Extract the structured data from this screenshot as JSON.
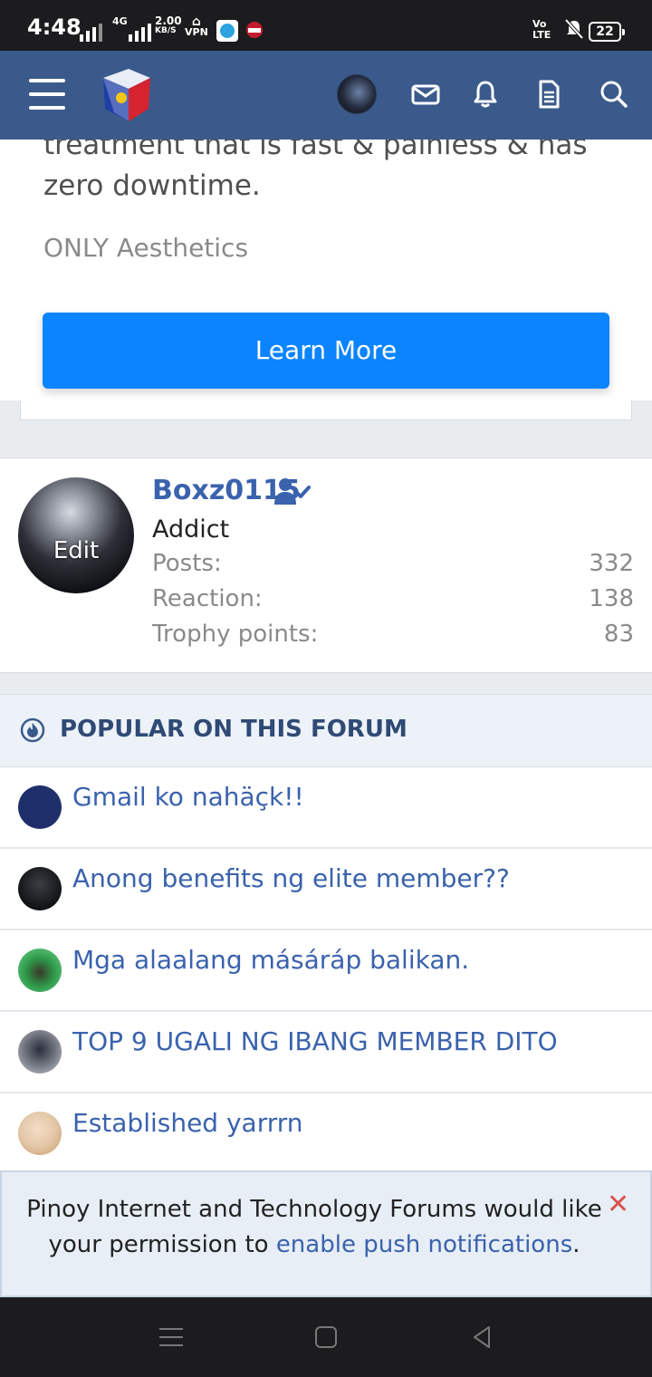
{
  "status_bar": {
    "time": "4:48",
    "network_label": "4G",
    "data_speed_value": "2.00",
    "data_speed_unit": "KB/S",
    "vpn_label": "VPN",
    "volte_label_top": "Vo",
    "volte_label_bottom": "LTE",
    "battery_level": "22",
    "icons": [
      "signal-icon",
      "telegram-icon",
      "app-notification-icon",
      "mute-icon",
      "battery-icon"
    ]
  },
  "header": {
    "icons": [
      "menu-icon",
      "site-logo",
      "user-avatar",
      "mail-icon",
      "bell-icon",
      "document-icon",
      "search-icon"
    ]
  },
  "ad": {
    "text_line1": "treatment that is fast & painless & has",
    "text_line2": "zero downtime.",
    "sponsor": "ONLY Aesthetics",
    "cta_label": "Learn More"
  },
  "user": {
    "name": "Boxz0115",
    "avatar_overlay": "Edit",
    "title": "Addict",
    "stats": [
      {
        "label": "Posts:",
        "value": "332"
      },
      {
        "label": "Reaction:",
        "value": "138"
      },
      {
        "label": "Trophy points:",
        "value": "83"
      }
    ]
  },
  "popular": {
    "heading": "POPULAR ON THIS FORUM",
    "threads": [
      {
        "title": "Gmail ko nahäçk!!",
        "avatar_color": "#1f2f6b"
      },
      {
        "title": "Anong benefits ng elite member??",
        "avatar_color": "#111315"
      },
      {
        "title": "Mga alaalang másáráp balikan.",
        "avatar_color": "#2f9a4a"
      },
      {
        "title": "TOP 9 UGALI NG IBANG MEMBER DITO",
        "avatar_color": "#7b7f8a"
      },
      {
        "title": "Established yarrrn",
        "avatar_color": "#e4c7a8"
      }
    ]
  },
  "notice": {
    "text_before": "Pinoy Internet and Technology Forums would like your permission to ",
    "link": "enable push notifications",
    "text_after": ".",
    "close_symbol": "✕"
  },
  "colors": {
    "header_bg": "#3a5a8c",
    "link": "#3a62ad",
    "cta": "#0a84ff",
    "close": "#d9534f"
  }
}
